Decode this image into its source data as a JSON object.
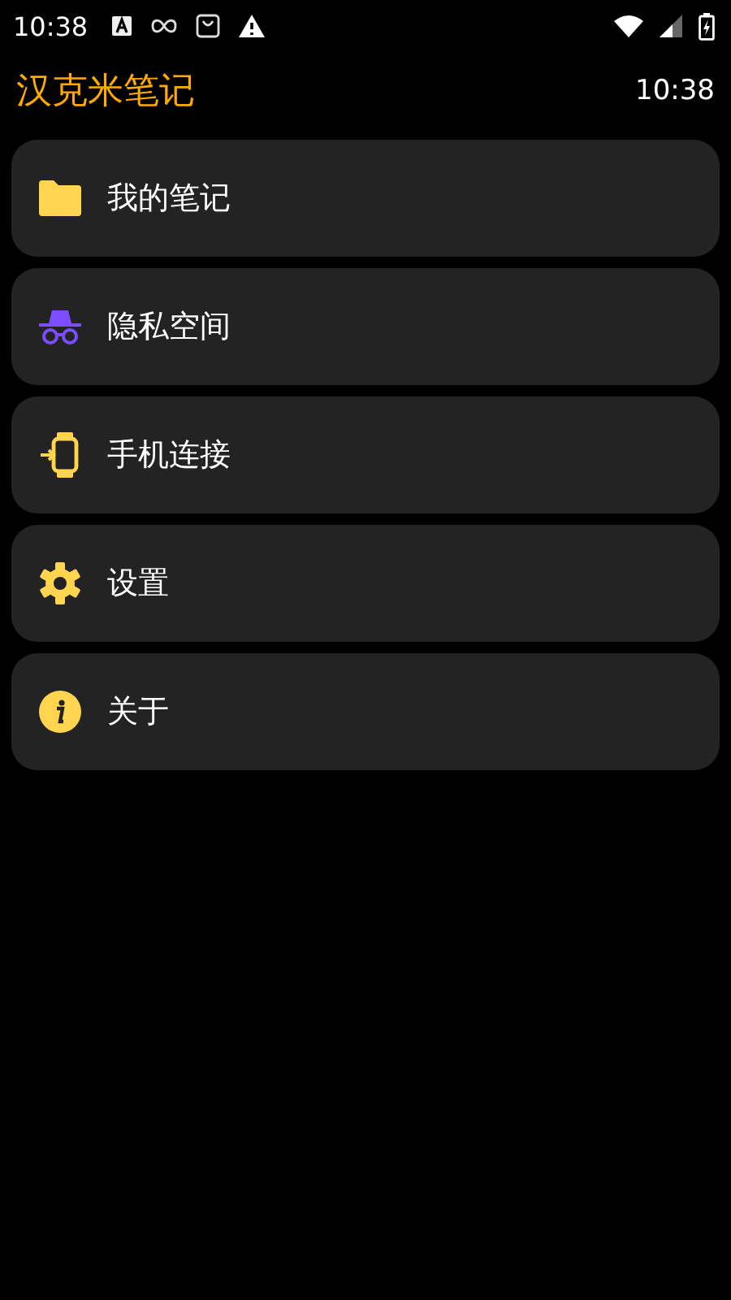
{
  "status_bar": {
    "time": "10:38"
  },
  "app_bar": {
    "title": "汉克米笔记",
    "clock": "10:38"
  },
  "menu": [
    {
      "kind": "folder",
      "label": "我的笔记"
    },
    {
      "kind": "incognito",
      "label": "隐私空间"
    },
    {
      "kind": "watch",
      "label": "手机连接"
    },
    {
      "kind": "gear",
      "label": "设置"
    },
    {
      "kind": "info",
      "label": "关于"
    }
  ]
}
